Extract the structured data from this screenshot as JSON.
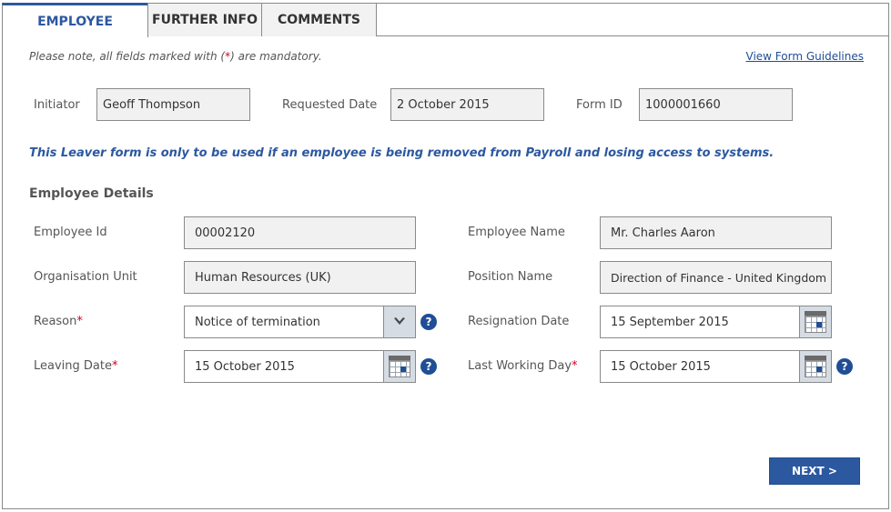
{
  "tabs": [
    {
      "label": "EMPLOYEE"
    },
    {
      "label": "FURTHER INFO"
    },
    {
      "label": "COMMENTS"
    }
  ],
  "note": {
    "prefix": "Please note, all fields marked with (",
    "star": "*",
    "suffix": ") are mandatory."
  },
  "guidelines_link": "View Form Guidelines",
  "header_fields": {
    "initiator": {
      "label": "Initiator",
      "value": "Geoff Thompson"
    },
    "requested_date": {
      "label": "Requested Date",
      "value": "2 October 2015"
    },
    "form_id": {
      "label": "Form ID",
      "value": "1000001660"
    }
  },
  "info_line": "This Leaver form is only to be used if an employee is being removed from Payroll and losing access to systems.",
  "section_title": "Employee Details",
  "employee": {
    "employee_id": {
      "label": "Employee Id",
      "value": "00002120"
    },
    "employee_name": {
      "label": "Employee Name",
      "value": "Mr. Charles Aaron"
    },
    "org_unit": {
      "label": "Organisation Unit",
      "value": "Human Resources (UK)"
    },
    "position_name": {
      "label": "Position Name",
      "value": "Direction of Finance - United Kingdom"
    },
    "reason": {
      "label": "Reason",
      "required": "*",
      "value": "Notice of termination"
    },
    "resignation_date": {
      "label": "Resignation Date",
      "value": "15 September 2015"
    },
    "leaving_date": {
      "label": "Leaving Date",
      "required": "*",
      "value": "15 October 2015"
    },
    "last_working_day": {
      "label": "Last Working Day",
      "required": "*",
      "value": "15 October 2015"
    }
  },
  "help_glyph": "?",
  "next_button": "NEXT >",
  "colors": {
    "accent": "#2c58a0",
    "required": "#d0021b",
    "field_bg": "#f1f1f1"
  }
}
